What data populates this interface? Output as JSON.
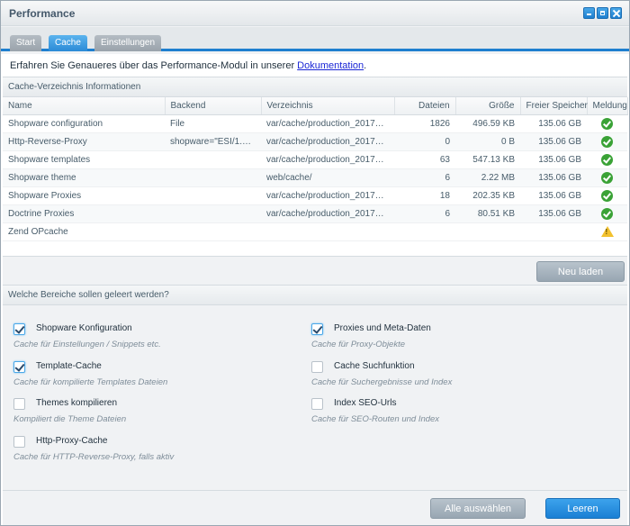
{
  "window": {
    "title": "Performance"
  },
  "tabs": [
    {
      "label": "Start",
      "active": false
    },
    {
      "label": "Cache",
      "active": true
    },
    {
      "label": "Einstellungen",
      "active": false
    }
  ],
  "info": {
    "text": "Erfahren Sie Genaueres über das Performance-Modul in unserer ",
    "link": "Dokumentation",
    "suffix": "."
  },
  "cache_panel": {
    "title": "Cache-Verzeichnis Informationen",
    "columns": [
      "Name",
      "Backend",
      "Verzeichnis",
      "Dateien",
      "Größe",
      "Freier Speicher",
      "Meldung"
    ],
    "rows": [
      {
        "name": "Shopware configuration",
        "backend": "File",
        "dir": "var/cache/production_201705...",
        "files": "1826",
        "size": "496.59 KB",
        "free": "135.06 GB",
        "status": "ok"
      },
      {
        "name": "Http-Reverse-Proxy",
        "backend": "shopware=\"ESI/1.0\", ...",
        "dir": "var/cache/production_201705...",
        "files": "0",
        "size": "0 B",
        "free": "135.06 GB",
        "status": "ok"
      },
      {
        "name": "Shopware templates",
        "backend": "",
        "dir": "var/cache/production_201705...",
        "files": "63",
        "size": "547.13 KB",
        "free": "135.06 GB",
        "status": "ok"
      },
      {
        "name": "Shopware theme",
        "backend": "",
        "dir": "web/cache/",
        "files": "6",
        "size": "2.22 MB",
        "free": "135.06 GB",
        "status": "ok"
      },
      {
        "name": "Shopware Proxies",
        "backend": "",
        "dir": "var/cache/production_201705...",
        "files": "18",
        "size": "202.35 KB",
        "free": "135.06 GB",
        "status": "ok"
      },
      {
        "name": "Doctrine Proxies",
        "backend": "",
        "dir": "var/cache/production_201705...",
        "files": "6",
        "size": "80.51 KB",
        "free": "135.06 GB",
        "status": "ok"
      },
      {
        "name": "Zend OPcache",
        "backend": "",
        "dir": "",
        "files": "",
        "size": "",
        "free": "",
        "status": "warning"
      }
    ],
    "reload_label": "Neu laden"
  },
  "clear_panel": {
    "title": "Welche Bereiche sollen geleert werden?",
    "left": [
      {
        "label": "Shopware Konfiguration",
        "help": "Cache für Einstellungen / Snippets etc.",
        "checked": true
      },
      {
        "label": "Template-Cache",
        "help": "Cache für kompilierte Templates Dateien",
        "checked": true
      },
      {
        "label": "Themes kompilieren",
        "help": "Kompiliert die Theme Dateien",
        "checked": false
      },
      {
        "label": "Http-Proxy-Cache",
        "help": "Cache für HTTP-Reverse-Proxy, falls aktiv",
        "checked": false
      }
    ],
    "right": [
      {
        "label": "Proxies und Meta-Daten",
        "help": "Cache für Proxy-Objekte",
        "checked": true
      },
      {
        "label": "Cache Suchfunktion",
        "help": "Cache für Suchergebnisse und Index",
        "checked": false
      },
      {
        "label": "Index SEO-Urls",
        "help": "Cache für SEO-Routen und Index",
        "checked": false
      }
    ],
    "select_all_label": "Alle auswählen",
    "clear_label": "Leeren"
  },
  "colors": {
    "accent": "#1e7fcf",
    "ok": "#3aa236",
    "warning": "#f2c12e"
  }
}
